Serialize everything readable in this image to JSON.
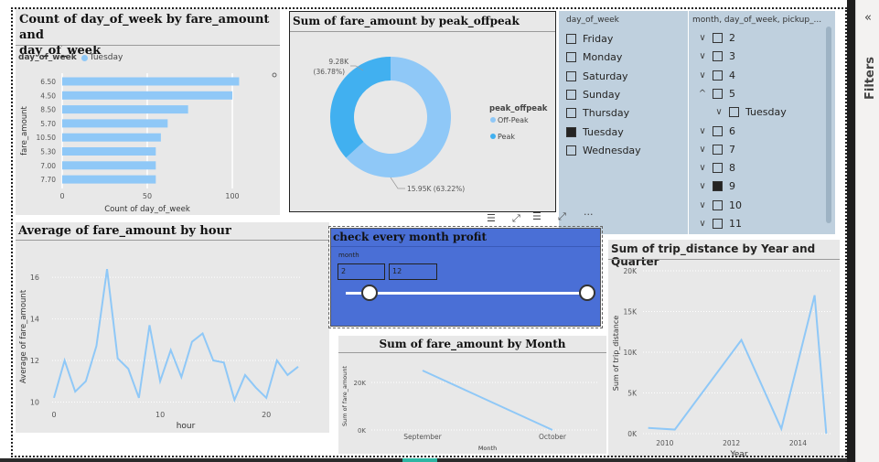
{
  "day_chart": {
    "title": "Count of day_of_week by fare_amount and day_of_week",
    "title_line1": "Count of day_of_week by fare_amount and",
    "title_line2": "day_of_week",
    "legend_field": "day_of_week",
    "legend_item": "Tuesday",
    "ylabel": "fare_amount",
    "xlabel": "Count of day_of_week",
    "x_ticks": [
      "0",
      "50",
      "100"
    ]
  },
  "donut_chart": {
    "title": "Sum of fare_amount by peak_offpeak",
    "legend_title": "peak_offpeak",
    "legend": [
      "Off-Peak",
      "Peak"
    ],
    "label_small_value": "9.28K",
    "label_small_pct": "(36.78%)",
    "label_large": "15.95K (63.22%)"
  },
  "day_slicer": {
    "header": "day_of_week",
    "items": [
      {
        "label": "Friday",
        "checked": false
      },
      {
        "label": "Monday",
        "checked": false
      },
      {
        "label": "Saturday",
        "checked": false
      },
      {
        "label": "Sunday",
        "checked": false
      },
      {
        "label": "Thursday",
        "checked": false
      },
      {
        "label": "Tuesday",
        "checked": true
      },
      {
        "label": "Wednesday",
        "checked": false
      }
    ]
  },
  "hier_slicer": {
    "header": "month, day_of_week, pickup_...",
    "items": [
      {
        "label": "2",
        "expanded": false,
        "checked": false
      },
      {
        "label": "3",
        "expanded": false,
        "checked": false
      },
      {
        "label": "4",
        "expanded": false,
        "checked": false
      },
      {
        "label": "5",
        "expanded": true,
        "checked": false
      },
      {
        "label": "Tuesday",
        "child": true,
        "expanded": false,
        "checked": false
      },
      {
        "label": "6",
        "expanded": false,
        "checked": false
      },
      {
        "label": "7",
        "expanded": false,
        "checked": false
      },
      {
        "label": "8",
        "expanded": false,
        "checked": false
      },
      {
        "label": "9",
        "expanded": false,
        "checked": true
      },
      {
        "label": "10",
        "expanded": false,
        "checked": false
      },
      {
        "label": "11",
        "expanded": false,
        "checked": false
      }
    ]
  },
  "hour_chart": {
    "title": "Average of fare_amount by hour",
    "xlabel": "hour",
    "ylabel": "Average of fare_amount",
    "y_ticks": [
      "10",
      "12",
      "14",
      "16"
    ],
    "x_ticks": [
      "0",
      "10",
      "20"
    ]
  },
  "month_slider": {
    "title": "check every month profit",
    "field": "month",
    "min_value": "2",
    "max_value": "12"
  },
  "fare_month_chart": {
    "title": "Sum of fare_amount by Month",
    "xlabel": "Month",
    "ylabel": "Sum of fare_amount",
    "y_ticks": [
      "0K",
      "20K"
    ],
    "x_ticks": [
      "September",
      "October"
    ]
  },
  "trip_chart": {
    "title": "Sum of trip_distance by Year and Quarter",
    "xlabel": "Year",
    "ylabel": "Sum of trip_distance",
    "y_ticks": [
      "0K",
      "5K",
      "10K",
      "15K",
      "20K"
    ],
    "x_ticks": [
      "2010",
      "2012",
      "2014"
    ]
  },
  "filters_pane": {
    "label": "Filters",
    "collapse_glyph": "«"
  },
  "colors": {
    "series": "#8fc8f7",
    "peak": "#41b0f0",
    "slider_bg": "#4a6fd6",
    "slicer_bg": "#bfd0de"
  },
  "chart_data": [
    {
      "type": "bar",
      "orientation": "horizontal",
      "title": "Count of day_of_week by fare_amount and day_of_week",
      "xlabel": "Count of day_of_week",
      "ylabel": "fare_amount",
      "categories": [
        "6.50",
        "4.50",
        "8.50",
        "5.70",
        "10.50",
        "5.30",
        "7.00",
        "7.70"
      ],
      "series": [
        {
          "name": "Tuesday",
          "values": [
            104,
            100,
            74,
            62,
            58,
            55,
            55,
            55
          ]
        }
      ],
      "xlim": [
        0,
        100
      ],
      "legend": "top-left"
    },
    {
      "type": "pie",
      "title": "Sum of fare_amount by peak_offpeak",
      "categories": [
        "Off-Peak",
        "Peak"
      ],
      "values": [
        15950,
        9280
      ],
      "legend": "right"
    },
    {
      "type": "line",
      "title": "Average of fare_amount by hour",
      "xlabel": "hour",
      "ylabel": "Average of fare_amount",
      "x": [
        0,
        1,
        2,
        3,
        4,
        5,
        6,
        7,
        8,
        9,
        10,
        11,
        12,
        13,
        14,
        15,
        16,
        17,
        18,
        19,
        20,
        21,
        22,
        23
      ],
      "values": [
        10.2,
        12.0,
        10.5,
        11.0,
        12.7,
        16.4,
        12.1,
        11.6,
        10.2,
        13.7,
        11.0,
        12.5,
        11.2,
        12.9,
        13.3,
        12.0,
        11.9,
        10.1,
        11.3,
        10.7,
        10.2,
        12.0,
        11.3,
        11.7
      ],
      "ylim": [
        9.8,
        16.8
      ]
    },
    {
      "type": "line",
      "title": "Sum of fare_amount by Month",
      "xlabel": "Month",
      "ylabel": "Sum of fare_amount",
      "categories": [
        "September",
        "October"
      ],
      "values": [
        25000,
        0
      ],
      "ylim": [
        0,
        25000
      ]
    },
    {
      "type": "line",
      "title": "Sum of trip_distance by Year and Quarter",
      "xlabel": "Year",
      "ylabel": "Sum of trip_distance",
      "x": [
        2009.5,
        2010.3,
        2012.3,
        2013.5,
        2014.5,
        2014.85
      ],
      "values": [
        700,
        500,
        11500,
        600,
        17000,
        0
      ],
      "ylim": [
        0,
        20000
      ],
      "xlim": [
        2009.4,
        2014.95
      ]
    }
  ]
}
